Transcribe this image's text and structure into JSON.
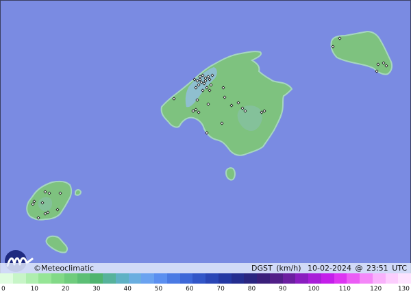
{
  "brand": {
    "copyright_symbol": "©",
    "name": "Meteoclimatic"
  },
  "caption": {
    "variable": "DGST",
    "unit": "(km/h)",
    "date": "10-02-2024",
    "at": "@",
    "time": "23:51",
    "timezone": "UTC"
  },
  "scale": {
    "tick_labels": [
      "0",
      "10",
      "20",
      "30",
      "40",
      "50",
      "60",
      "70",
      "80",
      "90",
      "100",
      "110",
      "120",
      "130"
    ],
    "colors": [
      "#dffcdf",
      "#c7f5c7",
      "#aeeeae",
      "#96e596",
      "#82d987",
      "#6fcc7d",
      "#5cbf75",
      "#4fb46f",
      "#56b29b",
      "#5fb1c4",
      "#6aaee0",
      "#6aa2f0",
      "#5b8ff0",
      "#4a7ae4",
      "#3d67d8",
      "#3256c8",
      "#2a46b6",
      "#2438a3",
      "#242d90",
      "#2a2580",
      "#3a1f7a",
      "#511e88",
      "#6b1fa0",
      "#8a1ec0",
      "#a81ed8",
      "#c41eea",
      "#dd35f2",
      "#eb5cf5",
      "#f487f8",
      "#f9b1fb",
      "#fccdfd",
      "#fde2fe"
    ]
  },
  "map": {
    "sea_color": "#7a8be2",
    "land_color": "#7ec27f",
    "highland_color": "#8fbfcf",
    "station_marker": "diamond-marker",
    "stations": [
      {
        "island": "mallorca",
        "count": 34
      },
      {
        "island": "menorca",
        "count": 6
      },
      {
        "island": "ibiza",
        "count": 10
      }
    ]
  }
}
